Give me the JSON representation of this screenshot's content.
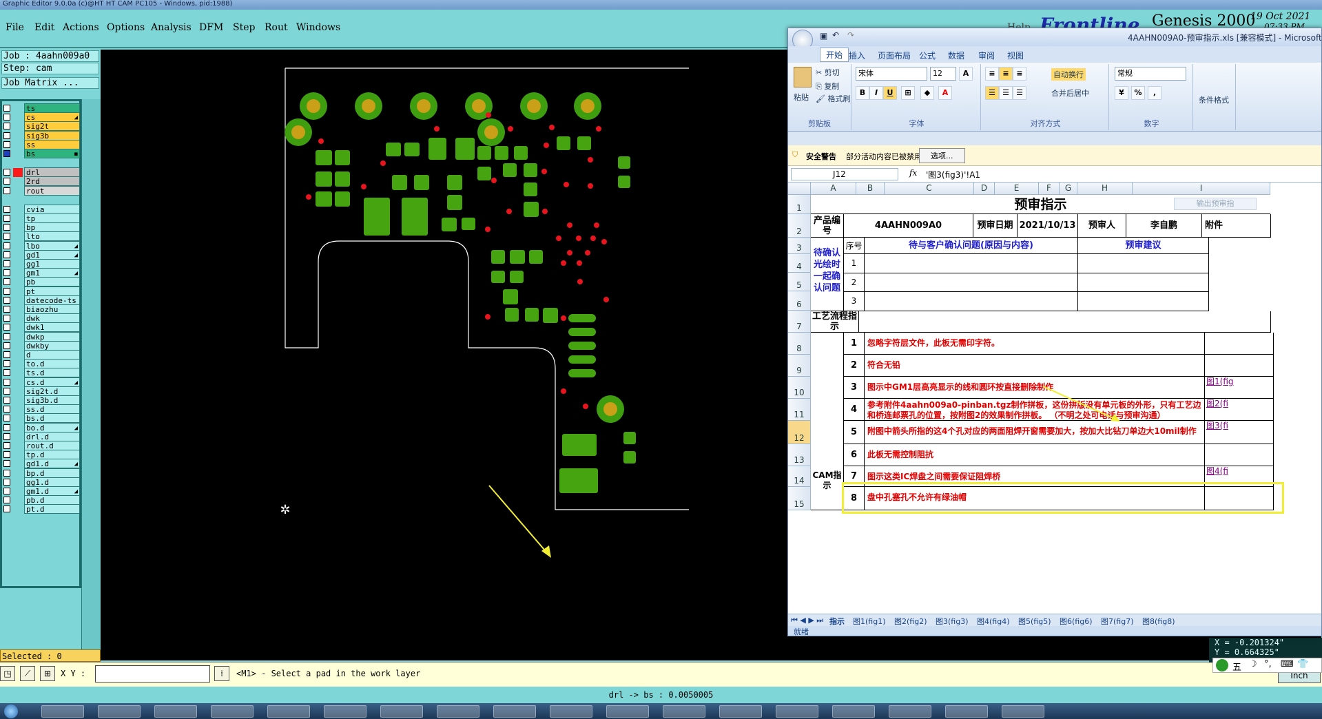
{
  "genesis": {
    "window_title": "Graphic Editor 9.0.0a (c)@HT HT CAM PC105 - Windows, pid:1988)",
    "menus": [
      "File",
      "Edit",
      "Actions",
      "Options",
      "Analysis",
      "DFM",
      "Step",
      "Rout",
      "Windows"
    ],
    "help_label": "Help",
    "brand": "Frontline",
    "product": "Genesis 2000",
    "date": "19 Oct 2021",
    "time": "07:33 PM",
    "job_label": "Job : 4aahn009a0",
    "step_label": "Step: cam",
    "job_matrix": "Job Matrix ...",
    "layers": [
      {
        "name": "ts",
        "color": "#2fb37f",
        "mark": ""
      },
      {
        "name": "cs",
        "color": "#ffcd3c",
        "mark": "◢"
      },
      {
        "name": "sig2t",
        "color": "#ffcd3c",
        "mark": ""
      },
      {
        "name": "sig3b",
        "color": "#ffcd3c",
        "mark": ""
      },
      {
        "name": "ss",
        "color": "#ffcd3c",
        "mark": ""
      },
      {
        "name": "bs",
        "color": "#2fb37f",
        "mark": "◼"
      },
      {
        "name": "drl",
        "color": "#c0c0c0",
        "mark": ""
      },
      {
        "name": "2rd",
        "color": "#c0c0c0",
        "mark": ""
      },
      {
        "name": "rout",
        "color": "#d8d8d8",
        "mark": ""
      },
      {
        "name": "cvia",
        "color": "#aeeeee",
        "mark": ""
      },
      {
        "name": "tp",
        "color": "#aeeeee",
        "mark": ""
      },
      {
        "name": "bp",
        "color": "#aeeeee",
        "mark": ""
      },
      {
        "name": "lto",
        "color": "#aeeeee",
        "mark": ""
      },
      {
        "name": "lbo",
        "color": "#aeeeee",
        "mark": "◢"
      },
      {
        "name": "gd1",
        "color": "#aeeeee",
        "mark": "◢"
      },
      {
        "name": "gg1",
        "color": "#aeeeee",
        "mark": ""
      },
      {
        "name": "gm1",
        "color": "#aeeeee",
        "mark": "◢"
      },
      {
        "name": "pb",
        "color": "#aeeeee",
        "mark": ""
      },
      {
        "name": "pt",
        "color": "#aeeeee",
        "mark": ""
      },
      {
        "name": "datecode-ts",
        "color": "#aeeeee",
        "mark": ""
      },
      {
        "name": "biaozhu",
        "color": "#aeeeee",
        "mark": ""
      },
      {
        "name": "dwk",
        "color": "#aeeeee",
        "mark": ""
      },
      {
        "name": "dwk1",
        "color": "#aeeeee",
        "mark": ""
      },
      {
        "name": "dwkp",
        "color": "#aeeeee",
        "mark": ""
      },
      {
        "name": "dwkby",
        "color": "#aeeeee",
        "mark": ""
      },
      {
        "name": "d",
        "color": "#aeeeee",
        "mark": ""
      },
      {
        "name": "to.d",
        "color": "#aeeeee",
        "mark": ""
      },
      {
        "name": "ts.d",
        "color": "#aeeeee",
        "mark": ""
      },
      {
        "name": "cs.d",
        "color": "#aeeeee",
        "mark": "◢"
      },
      {
        "name": "sig2t.d",
        "color": "#aeeeee",
        "mark": ""
      },
      {
        "name": "sig3b.d",
        "color": "#aeeeee",
        "mark": ""
      },
      {
        "name": "ss.d",
        "color": "#aeeeee",
        "mark": ""
      },
      {
        "name": "bs.d",
        "color": "#aeeeee",
        "mark": ""
      },
      {
        "name": "bo.d",
        "color": "#aeeeee",
        "mark": "◢"
      },
      {
        "name": "drl.d",
        "color": "#aeeeee",
        "mark": ""
      },
      {
        "name": "rout.d",
        "color": "#aeeeee",
        "mark": ""
      },
      {
        "name": "tp.d",
        "color": "#aeeeee",
        "mark": ""
      },
      {
        "name": "gd1.d",
        "color": "#aeeeee",
        "mark": "◢"
      },
      {
        "name": "bp.d",
        "color": "#aeeeee",
        "mark": ""
      },
      {
        "name": "gg1.d",
        "color": "#aeeeee",
        "mark": ""
      },
      {
        "name": "gm1.d",
        "color": "#aeeeee",
        "mark": "◢"
      },
      {
        "name": "pb.d",
        "color": "#aeeeee",
        "mark": ""
      },
      {
        "name": "pt.d",
        "color": "#aeeeee",
        "mark": ""
      }
    ],
    "selected": "Selected : 0",
    "xy_label": "X Y :",
    "status_msg": "<M1> - Select a pad in the work layer",
    "measure": "drl -> bs : 0.0050005",
    "coord_x": "X = -0.201324\"",
    "coord_y": "Y = 0.664325\"",
    "units": "Inch",
    "ime": "五",
    "colors": {
      "pad_green": "#46a410",
      "pad_ring": "#3f9e10",
      "pad_copper": "#c9a018",
      "via_red": "#e8141e",
      "outline": "#ffffff",
      "arrow": "#f2ee34"
    }
  },
  "excel": {
    "title": "4AAHN009A0-预审指示.xls [兼容模式] - Microsoft Excel",
    "tabs": [
      "开始",
      "插入",
      "页面布局",
      "公式",
      "数据",
      "审阅",
      "视图"
    ],
    "clipboard": {
      "paste": "粘贴",
      "cut": "剪切",
      "copy": "复制",
      "painter": "格式刷",
      "label": "剪贴板"
    },
    "font": {
      "name": "宋体",
      "size": "12",
      "label": "字体"
    },
    "align": {
      "wrap": "自动换行",
      "merge": "合并后居中",
      "label": "对齐方式"
    },
    "number": {
      "format": "常规",
      "label": "数字"
    },
    "cond": "条件格式",
    "security_title": "安全警告",
    "security_msg": "部分活动内容已被禁用。",
    "security_btn": "选项...",
    "namebox": "J12",
    "formula": "'图3(fig3)'!A1",
    "columns": [
      "A",
      "B",
      "C",
      "D",
      "E",
      "F",
      "G",
      "H",
      "I"
    ],
    "rows": [
      "1",
      "2",
      "3",
      "4",
      "5",
      "6",
      "7",
      "8",
      "9",
      "10",
      "11",
      "12",
      "13",
      "14",
      "15"
    ],
    "sheet": {
      "title": "预审指示",
      "output_btn": "输出预审指",
      "product_label": "产品编号",
      "product_value": "4AAHN009A0",
      "date_label": "预审日期",
      "date_value": "2021/10/13",
      "reviewer_label": "预审人",
      "reviewer_value": "李自鹏",
      "attach_label": "附件",
      "seq_label": "序号",
      "issues_label": "待与客户确认问题(原因与内容)",
      "suggest_label": "预审建议",
      "confirm_label": "待确认光绘时一起确认问题",
      "confirm_nums": [
        "1",
        "2",
        "3"
      ],
      "process_label": "工艺流程指示",
      "cam_label": "CAM指示",
      "instructions": [
        {
          "n": "1",
          "text": "忽略字符层文件，此板无需印字符。",
          "link": ""
        },
        {
          "n": "2",
          "text": "符合无铅",
          "link": ""
        },
        {
          "n": "3",
          "text": "图示中GM1层高亮显示的线和圆环按直接删除制作",
          "link": "图1(fig"
        },
        {
          "n": "4",
          "text": "参考附件4aahn009a0-pinban.tgz制作拼板，这份拼版没有单元板的外形，只有工艺边和桥连邮票孔的位置，按附图2的效果制作拼板。 （不明之处可电话与预审沟通）",
          "link": "图2(fi"
        },
        {
          "n": "5",
          "text": "附图中箭头所指的这4个孔对应的两面阻焊开窗需要加大，按加大比钻刀单边大10mil制作",
          "link": "图3(fi"
        },
        {
          "n": "6",
          "text": "此板无需控制阻抗",
          "link": ""
        },
        {
          "n": "7",
          "text": "图示这类IC焊盘之间需要保证阻焊桥",
          "link": "图4(fi"
        },
        {
          "n": "8",
          "text": "盘中孔塞孔不允许有绿油帽",
          "link": ""
        }
      ]
    },
    "sheet_tabs": [
      "指示",
      "图1(fig1)",
      "图2(fig2)",
      "图3(fig3)",
      "图4(fig4)",
      "图5(fig5)",
      "图6(fig6)",
      "图7(fig7)",
      "图8(fig8)"
    ],
    "status": "就绪"
  }
}
